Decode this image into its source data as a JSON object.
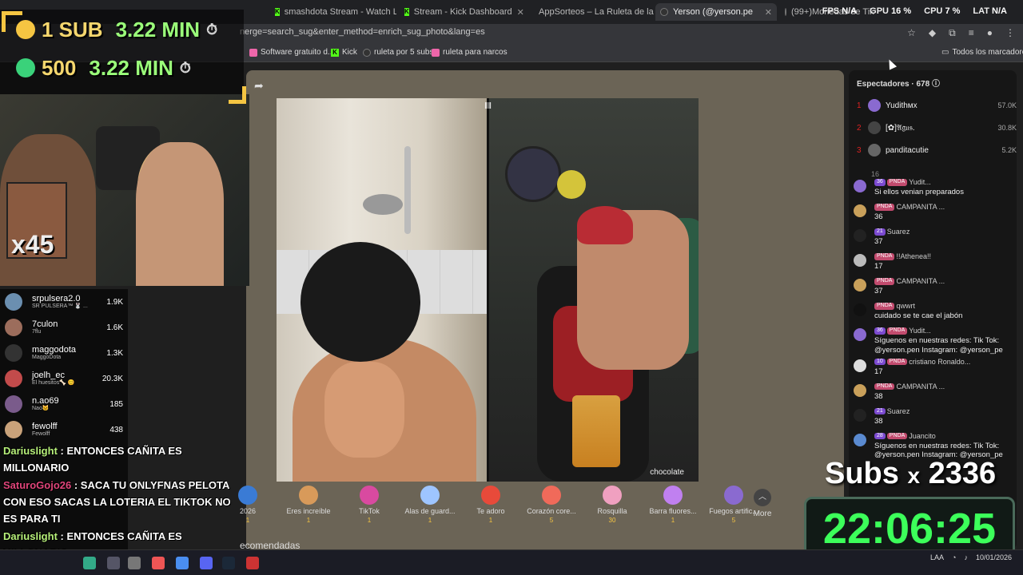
{
  "tabs": [
    {
      "label": "smashdota Stream - Watch Liv",
      "x": "close"
    },
    {
      "label": "Stream - Kick Dashboard",
      "x": "close"
    },
    {
      "label": "AppSorteos – La Ruleta de la S",
      "x": "close"
    },
    {
      "label": "Yerson (@yerson.pe",
      "x": "close"
    },
    {
      "label": "(99+)Monedas de TikTok",
      "x": "close"
    }
  ],
  "perf": {
    "fps_label": "FPS",
    "fps": "N/A",
    "gpu_label": "GPU",
    "gpu": "16 %",
    "cpu_label": "CPU",
    "cpu": "7 %",
    "lat_label": "LAT",
    "lat": "N/A"
  },
  "url": "nerge=search_sug&enter_method=enrich_sug_photo&lang=es",
  "bookmarks": [
    "Software gratuito d...",
    "Kick",
    "ruleta por 5 subs",
    "ruleta para narcos",
    "Todos los marcadores"
  ],
  "overlay": {
    "sub_row": {
      "label": "1 SUB",
      "time": "3.22 MIN"
    },
    "coins_row": {
      "label": "500",
      "time": "3.22 MIN"
    },
    "multiplier": "x45",
    "subs_label": "Subs ",
    "subs_x": "x",
    "subs_count": "2336",
    "timer": "22:06:25"
  },
  "gifters": [
    {
      "name": "srpulsera2.0",
      "sub": "SR PULSERA™ 🐰 ...",
      "value": "1.9K",
      "color": "#6b8fb0"
    },
    {
      "name": "7culon",
      "sub": "7flu",
      "value": "1.6K",
      "color": "#9c6d5c"
    },
    {
      "name": "maggodota",
      "sub": "MaggoDota",
      "value": "1.3K",
      "color": "#333333"
    },
    {
      "name": "joelh_ec",
      "sub": "El huesitos🦴 😊",
      "value": "20.3K",
      "color": "#c24b4b"
    },
    {
      "name": "n.ao69",
      "sub": "Nao🐱",
      "value": "185",
      "color": "#7a5b8b"
    },
    {
      "name": "fewolff",
      "sub": "Fewolff",
      "value": "438",
      "color": "#c9a27a"
    }
  ],
  "stream_chat": [
    {
      "user": "Dariuslight",
      "text": " : ENTONCES CAÑITA ES MILLONARIO"
    },
    {
      "user": "SaturoGojo26",
      "text": " : SACA TU ONLYFNAS PELOTA CON ESO SACAS LA LOTERIA EL TIKTOK NO ES PARA TI"
    },
    {
      "user": "Dariuslight",
      "text": " : ENTONCES CAÑITA ES MILLONARIO"
    }
  ],
  "video": {
    "label": "chocolate"
  },
  "gifts": [
    {
      "name": "2026",
      "cost": "1",
      "color": "#3a7bd5"
    },
    {
      "name": "Eres increíble",
      "cost": "1",
      "color": "#d89a5a"
    },
    {
      "name": "TikTok",
      "cost": "1",
      "color": "#d94aa0"
    },
    {
      "name": "Alas de guard...",
      "cost": "1",
      "color": "#9ec5ff"
    },
    {
      "name": "Te adoro",
      "cost": "1",
      "color": "#e84a3a"
    },
    {
      "name": "Corazón core...",
      "cost": "5",
      "color": "#f06a5a"
    },
    {
      "name": "Rosquilla",
      "cost": "30",
      "color": "#f0a0c0"
    },
    {
      "name": "Barra fluores...",
      "cost": "1",
      "color": "#c080f0"
    },
    {
      "name": "Fuegos artific...",
      "cost": "5",
      "color": "#8a6ad0"
    }
  ],
  "more_label": "More",
  "recommend": "ecomendadas",
  "viewers": {
    "title": "Espectadores · 678",
    "top": [
      {
        "rank": "1",
        "name": "Yudithмх",
        "score": "57.0K",
        "color": "#8a6ad0"
      },
      {
        "rank": "2",
        "name": "[✿]𝔄𝔤𝔲𝔰.",
        "score": "30.8K",
        "color": "#444444"
      },
      {
        "rank": "3",
        "name": "panditacutie",
        "score": "5.2K",
        "color": "#666666"
      }
    ],
    "stray": "16",
    "chat": [
      {
        "badges": [
          "36",
          "PNDA"
        ],
        "user": "Yudit...",
        "text": "Si ellos venian preparados",
        "color": "#8a6ad0"
      },
      {
        "badges": [
          "PNDA"
        ],
        "user": "CAMPANITA ...",
        "text": "36",
        "color": "#c9a05a"
      },
      {
        "badges": [
          "21"
        ],
        "user": "Suarez",
        "text": "37",
        "color": "#222222"
      },
      {
        "badges": [
          "PNDA"
        ],
        "user": "!!Athenea!!",
        "text": "17",
        "color": "#bbbbbb"
      },
      {
        "badges": [
          "PNDA"
        ],
        "user": "CAMPANITA ...",
        "text": "37",
        "color": "#c9a05a"
      },
      {
        "badges": [
          "PNDA"
        ],
        "user": "qwwrt",
        "text": "cuidado se te cae el jabón",
        "color": "#111111"
      },
      {
        "badges": [
          "36",
          "PNDA"
        ],
        "user": "Yudit...",
        "text": "Síguenos en nuestras redes: Tik Tok: @yerson.pen Instagram: @yerson_pe",
        "color": "#8a6ad0"
      },
      {
        "badges": [
          "10",
          "PNDA"
        ],
        "user": "cristiano Ronaldo...",
        "text": "17",
        "color": "#dddddd"
      },
      {
        "badges": [
          "PNDA"
        ],
        "user": "CAMPANITA ...",
        "text": "38",
        "color": "#c9a05a"
      },
      {
        "badges": [
          "21"
        ],
        "user": "Suarez",
        "text": "38",
        "color": "#222222"
      },
      {
        "badges": [
          "28",
          "PNDA"
        ],
        "user": "Juancito",
        "text": "Síguenos en nuestras redes: Tik Tok: @yerson.pen Instagram: @yerson_pe",
        "color": "#5a8ad0"
      }
    ]
  },
  "taskbar": {
    "lang": "LAA",
    "time": "",
    "date": "10/01/2026"
  }
}
